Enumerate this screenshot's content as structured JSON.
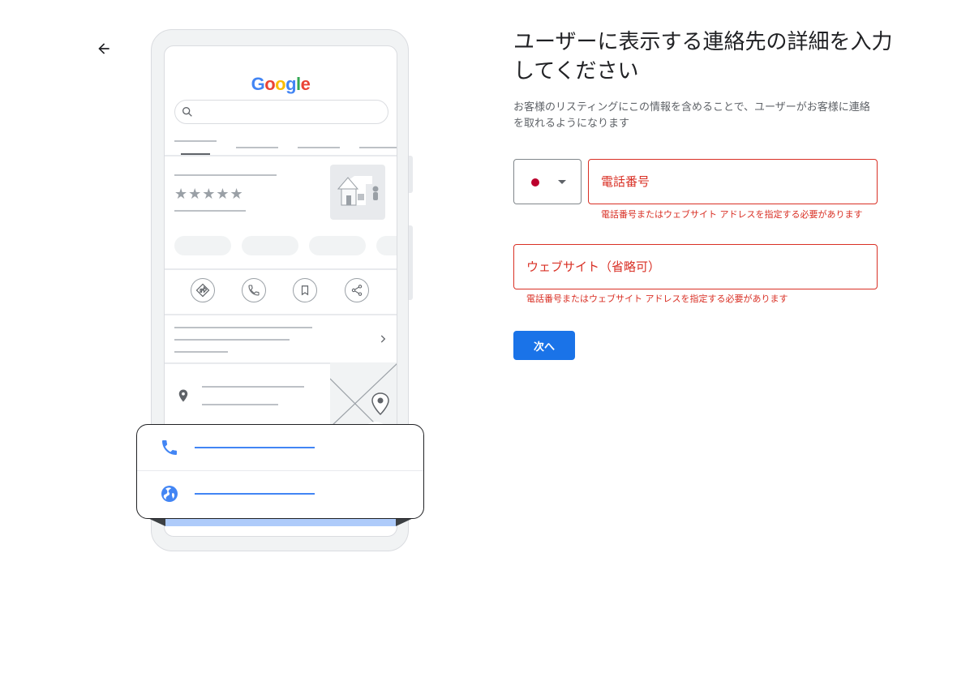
{
  "nav": {
    "back_icon": "arrow-back-icon"
  },
  "illustration": {
    "logo_letters": [
      {
        "char": "G",
        "color": "#4285F4"
      },
      {
        "char": "o",
        "color": "#EA4335"
      },
      {
        "char": "o",
        "color": "#FBBC05"
      },
      {
        "char": "g",
        "color": "#4285F4"
      },
      {
        "char": "l",
        "color": "#34A853"
      },
      {
        "char": "e",
        "color": "#EA4335"
      }
    ],
    "stars": "★★★★★",
    "card_icons": [
      "phone-icon",
      "globe-icon"
    ]
  },
  "form": {
    "title": "ユーザーに表示する連絡先の詳細を入力してください",
    "subtitle": "お客様のリスティングにこの情報を含めることで、ユーザーがお客様に連絡を取れるようになります",
    "country_flag_color": "#BC002D",
    "phone_placeholder": "電話番号",
    "phone_error": "電話番号またはウェブサイト アドレスを指定する必要があります",
    "website_placeholder": "ウェブサイト（省略可）",
    "website_error": "電話番号またはウェブサイト アドレスを指定する必要があります",
    "next_label": "次へ",
    "error_color": "#D93025",
    "accent_color": "#1A73E8"
  }
}
